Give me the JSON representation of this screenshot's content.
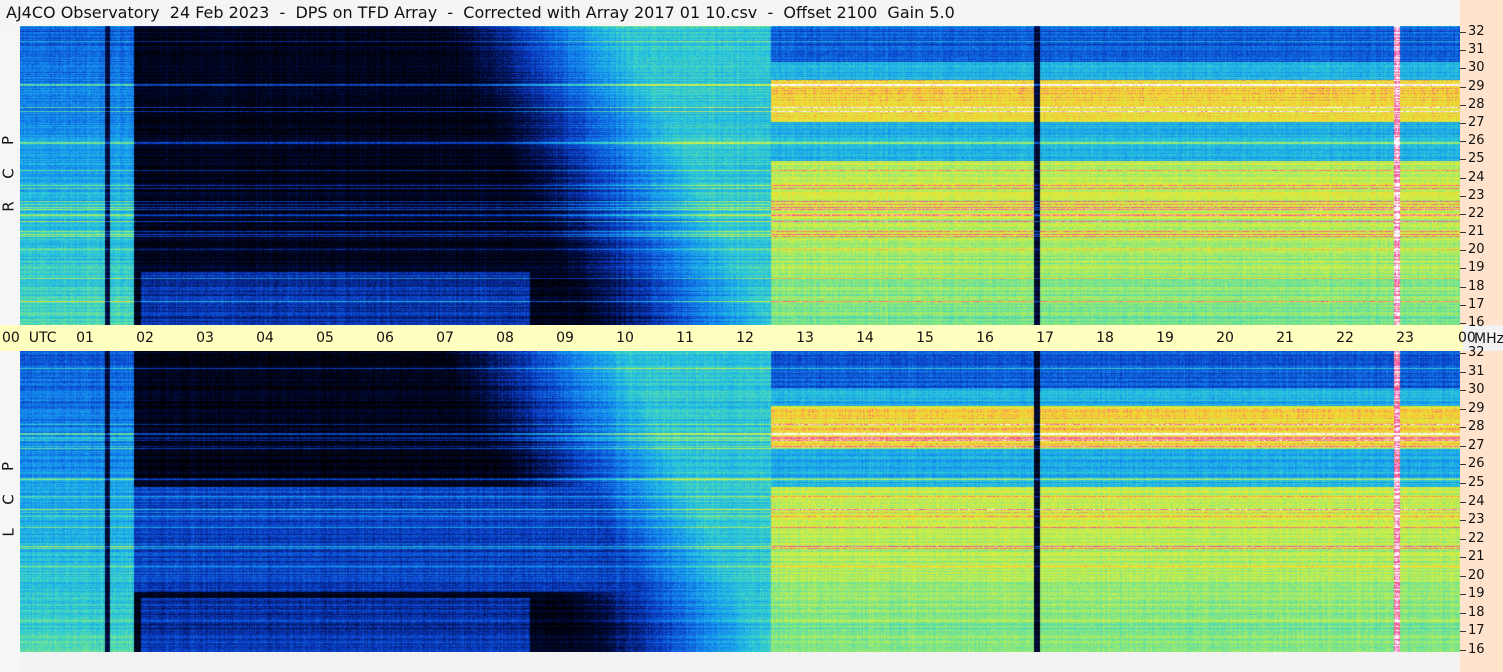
{
  "header": {
    "title": "AJ4CO Observatory  24 Feb 2023  -  DPS on TFD Array  -  Corrected with Array 2017 01 10.csv  -  Offset 2100  Gain 5.0"
  },
  "panels": [
    {
      "id": "rcp",
      "label_letters": [
        "P",
        "C",
        "R"
      ]
    },
    {
      "id": "lcp",
      "label_letters": [
        "P",
        "C",
        "L"
      ]
    }
  ],
  "time_axis": {
    "labels": [
      "00  UTC",
      "01",
      "02",
      "03",
      "04",
      "05",
      "06",
      "07",
      "08",
      "09",
      "10",
      "11",
      "12",
      "13",
      "14",
      "15",
      "16",
      "17",
      "18",
      "19",
      "20",
      "21",
      "22",
      "23",
      "00"
    ],
    "unit": "MHz"
  },
  "freq_axis": {
    "ticks": [
      "32",
      "31",
      "30",
      "29",
      "28",
      "27",
      "26",
      "25",
      "24",
      "23",
      "22",
      "21",
      "20",
      "19",
      "18",
      "17",
      "16"
    ]
  },
  "colors": {
    "time_axis_bg": "#ffffc0",
    "freq_axis_bg": "#ffe3cc"
  }
}
